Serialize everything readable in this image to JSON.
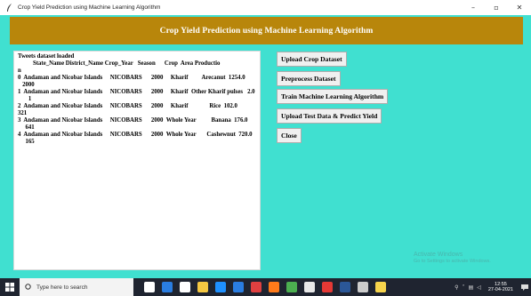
{
  "window": {
    "title": "Crop Yield Prediction using Machine Learning Algorithm",
    "minimize": "–",
    "maximize": "▫",
    "close": "✕"
  },
  "banner": {
    "title": "Crop Yield Prediction using Machine Learning Algorithm"
  },
  "output": {
    "lines": [
      "Tweets dataset loaded",
      "          State_Name District_Name Crop_Year   Season      Crop  Area Productio",
      "n",
      "0  Andaman and Nicobar Islands     NICOBARS      2000     Kharif         Arecanut  1254.0",
      "   2000",
      "1  Andaman and Nicobar Islands     NICOBARS      2000     Kharif  Other Kharif pulses   2.0",
      "       1",
      "2  Andaman and Nicobar Islands     NICOBARS      2000     Kharif              Rice  102.0",
      "321",
      "3  Andaman and Nicobar Islands     NICOBARS      2000  Whole Year          Banana  176.0",
      "     641",
      "4  Andaman and Nicobar Islands     NICOBARS      2000  Whole Year       Cashewnut  720.0",
      "     165"
    ]
  },
  "buttons": {
    "upload": "Upload Crop Dataset",
    "preprocess": "Preprocess Dataset",
    "train": "Train Machine Learning Algorithm",
    "predict": "Upload Test Data & Predict Yield",
    "close": "Close"
  },
  "watermark": {
    "line1": "Activate Windows",
    "line2": "Go to Settings to activate Windows."
  },
  "taskbar": {
    "search_placeholder": "Type here to search",
    "time": "12:55",
    "date": "27-04-2021",
    "icons": [
      "task-view-icon",
      "edge-icon",
      "store-icon",
      "file-explorer-icon",
      "ie-icon",
      "mail-icon",
      "media-icon",
      "firefox-icon",
      "chrome-icon",
      "photos-icon",
      "folder-icon",
      "word-icon",
      "terminal-icon",
      "python-icon"
    ],
    "icon_colors": [
      "#ffffff",
      "#2a7de1",
      "#ffffff",
      "#f5c842",
      "#1e90ff",
      "#2a7de1",
      "#e04040",
      "#ff7a1a",
      "#4caf50",
      "#e8e8e8",
      "#e53935",
      "#2b5797",
      "#cccccc",
      "#f7d44c"
    ]
  }
}
